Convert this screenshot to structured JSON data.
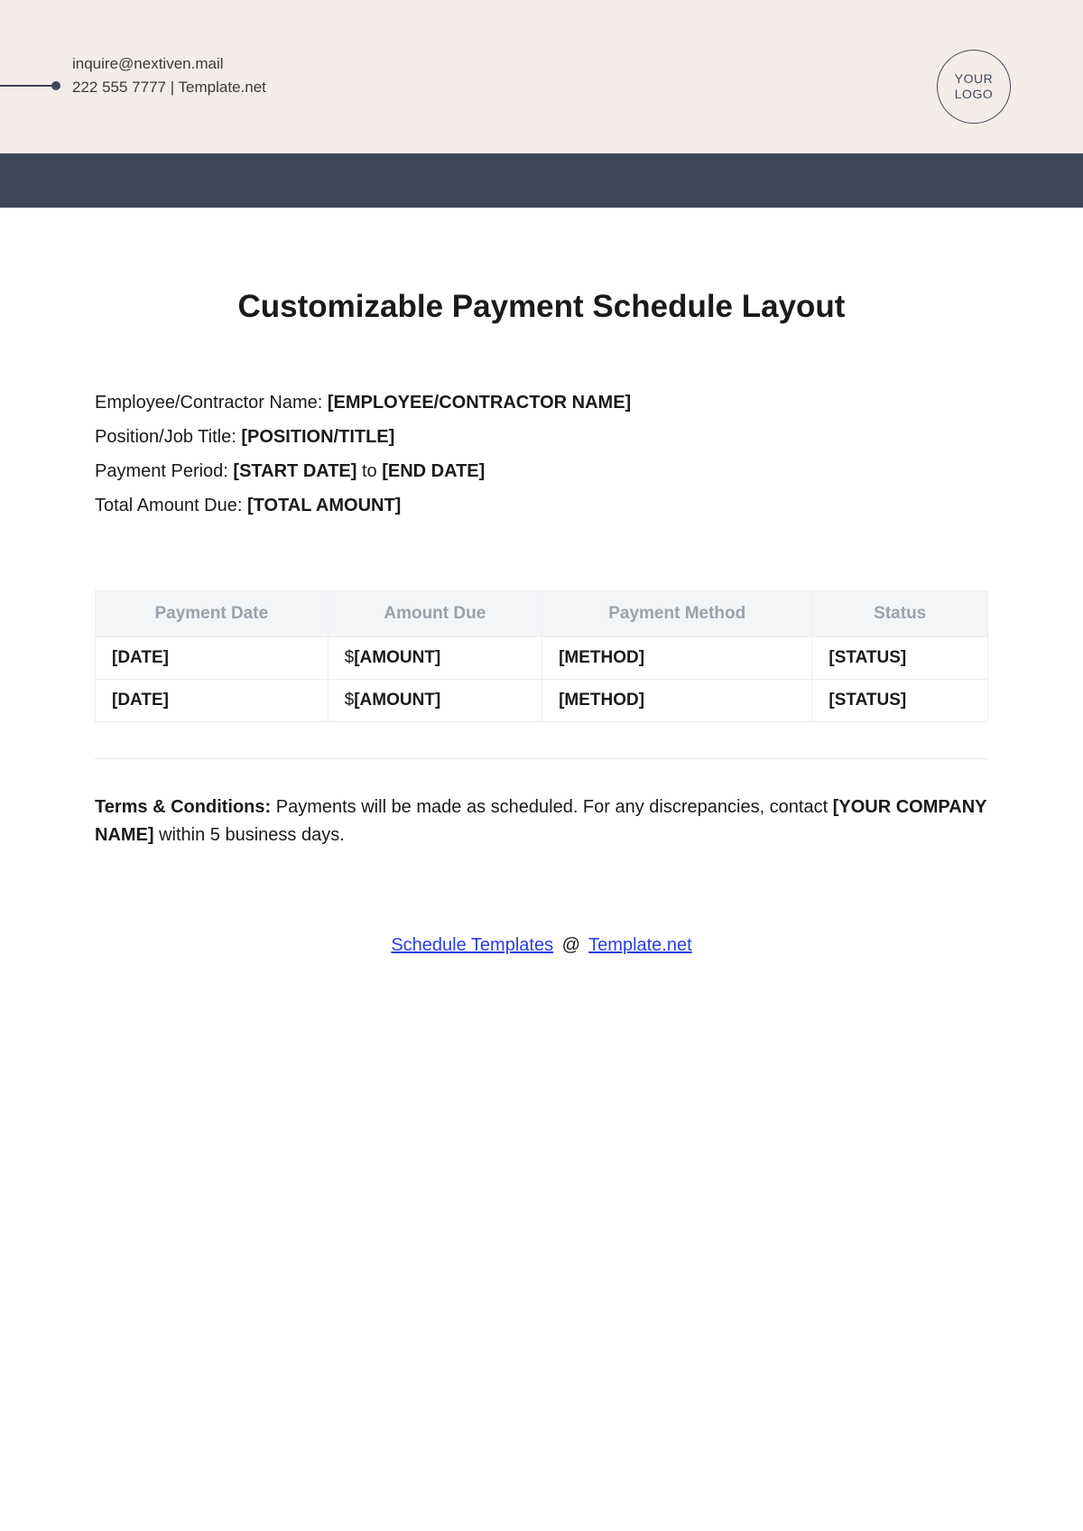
{
  "header": {
    "email": "inquire@nextiven.mail",
    "phone_site": "222 555 7777 | Template.net",
    "logo_line1": "YOUR",
    "logo_line2": "LOGO"
  },
  "title": "Customizable Payment Schedule Layout",
  "fields": {
    "name_label": "Employee/Contractor Name: ",
    "name_value": "[EMPLOYEE/CONTRACTOR NAME]",
    "position_label": "Position/Job Title: ",
    "position_value": "[POSITION/TITLE]",
    "period_label": "Payment Period: ",
    "period_start": "[START DATE]",
    "period_to": " to ",
    "period_end": "[END DATE]",
    "total_label": "Total Amount Due: ",
    "total_value": "[TOTAL AMOUNT]"
  },
  "table": {
    "headers": [
      "Payment Date",
      "Amount Due",
      "Payment Method",
      "Status"
    ],
    "rows": [
      {
        "date": "[DATE]",
        "amount_prefix": "$",
        "amount": "[AMOUNT]",
        "method": "[METHOD]",
        "status": "[STATUS]"
      },
      {
        "date": "[DATE]",
        "amount_prefix": "$",
        "amount": "[AMOUNT]",
        "method": "[METHOD]",
        "status": "[STATUS]"
      }
    ]
  },
  "terms": {
    "label": "Terms & Conditions: ",
    "text1": "Payments will be made as scheduled. For any discrepancies, contact ",
    "company": "[YOUR COMPANY NAME]",
    "text2": " within 5 business days."
  },
  "footer": {
    "link1": "Schedule Templates",
    "at": "@",
    "link2": "Template.net"
  }
}
